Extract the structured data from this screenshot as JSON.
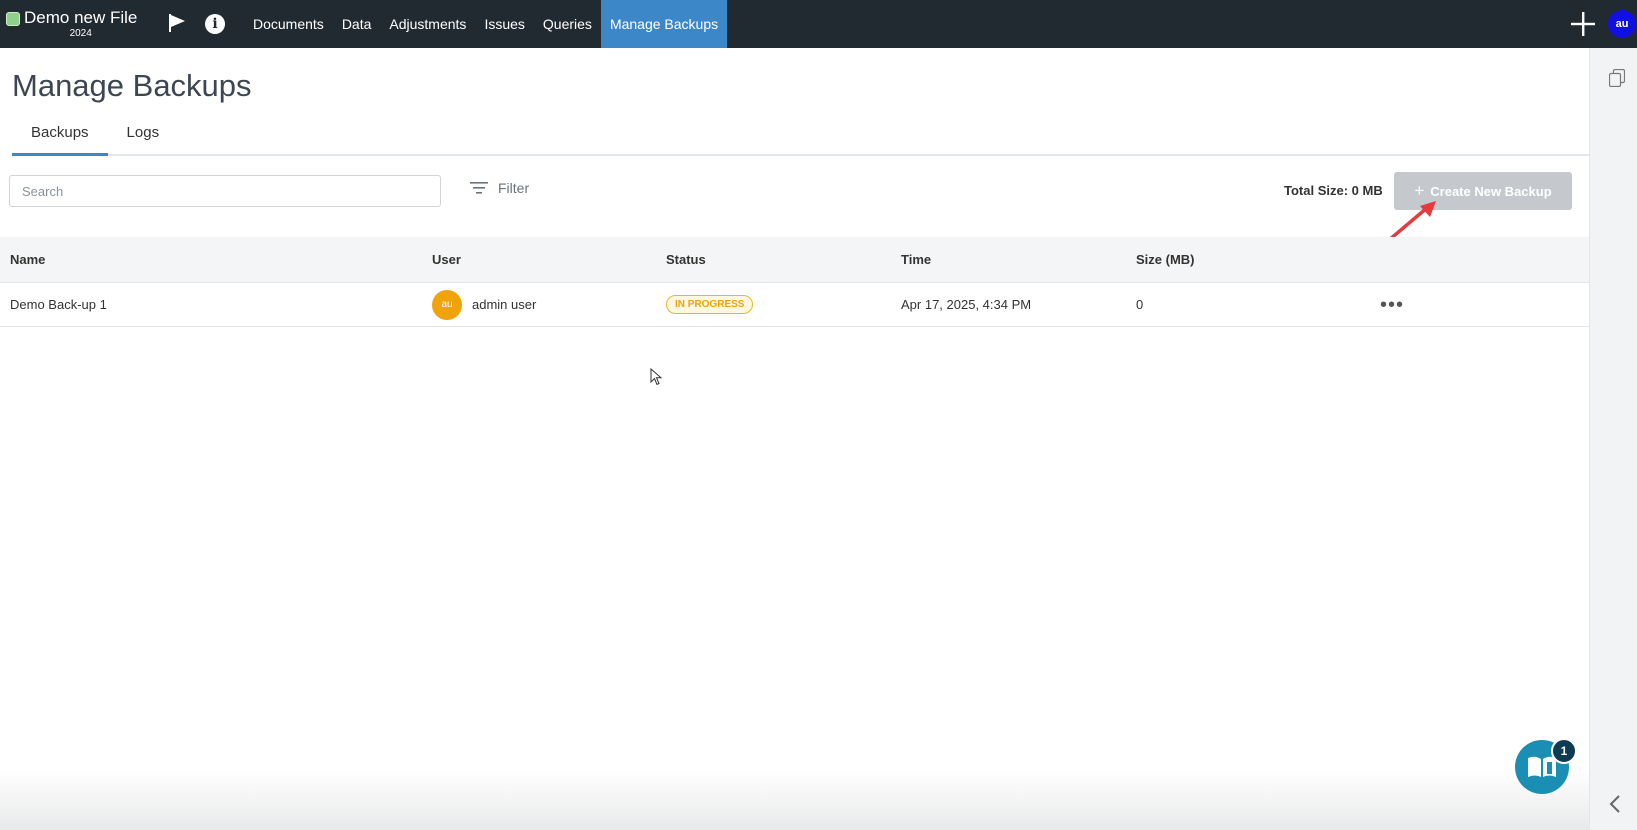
{
  "app": {
    "file_name": "Demo new File",
    "file_year": "2024",
    "user_initials": "au"
  },
  "nav": {
    "items": [
      {
        "label": "Documents"
      },
      {
        "label": "Data"
      },
      {
        "label": "Adjustments"
      },
      {
        "label": "Issues"
      },
      {
        "label": "Queries"
      },
      {
        "label": "Manage Backups",
        "active": true
      }
    ]
  },
  "page": {
    "title": "Manage Backups",
    "tabs": [
      {
        "label": "Backups",
        "active": true
      },
      {
        "label": "Logs"
      }
    ]
  },
  "toolbar": {
    "search_placeholder": "Search",
    "filter_label": "Filter",
    "total_size": "Total Size: 0 MB",
    "create_label": "Create New Backup",
    "create_plus": "+"
  },
  "table": {
    "headers": {
      "name": "Name",
      "user": "User",
      "status": "Status",
      "time": "Time",
      "size": "Size (MB)"
    },
    "rows": [
      {
        "name": "Demo Back-up 1",
        "user_initials": "au",
        "user": "admin user",
        "status": "IN PROGRESS",
        "time": "Apr 17, 2025, 4:34 PM",
        "size": "0",
        "actions": "•••"
      }
    ]
  },
  "help": {
    "badge_count": "1"
  },
  "colors": {
    "navbar_bg": "#222a31",
    "nav_active": "#3c87c8",
    "status_in_progress": "#f0a30a",
    "create_button_disabled": "#c5c9cd",
    "annotation_arrow": "#e8393b"
  },
  "icons": [
    "flag-icon",
    "info-icon",
    "plus-icon",
    "filter-icon",
    "copy-icon",
    "chevron-left-icon",
    "help-book-icon",
    "more-icon"
  ]
}
